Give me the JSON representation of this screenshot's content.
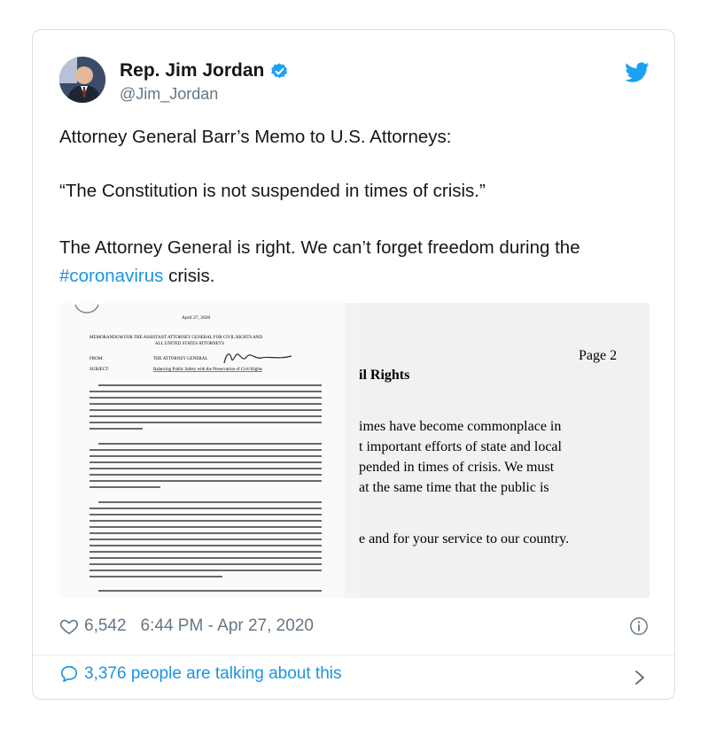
{
  "tweet": {
    "author_name": "Rep. Jim Jordan",
    "handle": "@Jim_Jordan",
    "line1": "Attorney General Barr’s Memo to U.S. Attorneys:",
    "line2": "“The Constitution is not suspended in times of crisis.”",
    "line3": "The Attorney General is right. We can’t forget freedom during the",
    "hashtag": "#coronavirus",
    "line3_end": " crisis.",
    "likes": "6,542",
    "timestamp": "6:44 PM - Apr 27, 2020",
    "talking": "3,376 people are talking about this"
  },
  "memo": {
    "date": "April 27, 2020",
    "header1": "MEMORANDUM FOR THE ASSISTANT ATTORNEY GENERAL FOR CIVIL RIGHTS AND",
    "header2": "ALL UNITED STATES ATTORNEYS",
    "from_label": "FROM:",
    "from_value": "THE ATTORNEY GENERAL",
    "subject_label": "SUBJECT:",
    "subject_value": "Balancing Public Safety with the Preservation of Civil Rights",
    "page": "Page 2",
    "rights": "il Rights",
    "r1": "imes have become commonplace in",
    "r2": "t important efforts of state and local",
    "r3": "pended in times of crisis.  We must",
    "r4": "at the same time that the public is",
    "r5": "e and for your service to our country."
  },
  "colors": {
    "accent": "#1b95e0",
    "text": "#14171a",
    "muted": "#657786"
  },
  "icons": {
    "verified": "verified-badge-icon",
    "bird": "twitter-bird-icon",
    "heart": "heart-icon",
    "info": "info-icon",
    "bubble": "comment-bubble-icon",
    "chevron": "chevron-right-icon"
  }
}
